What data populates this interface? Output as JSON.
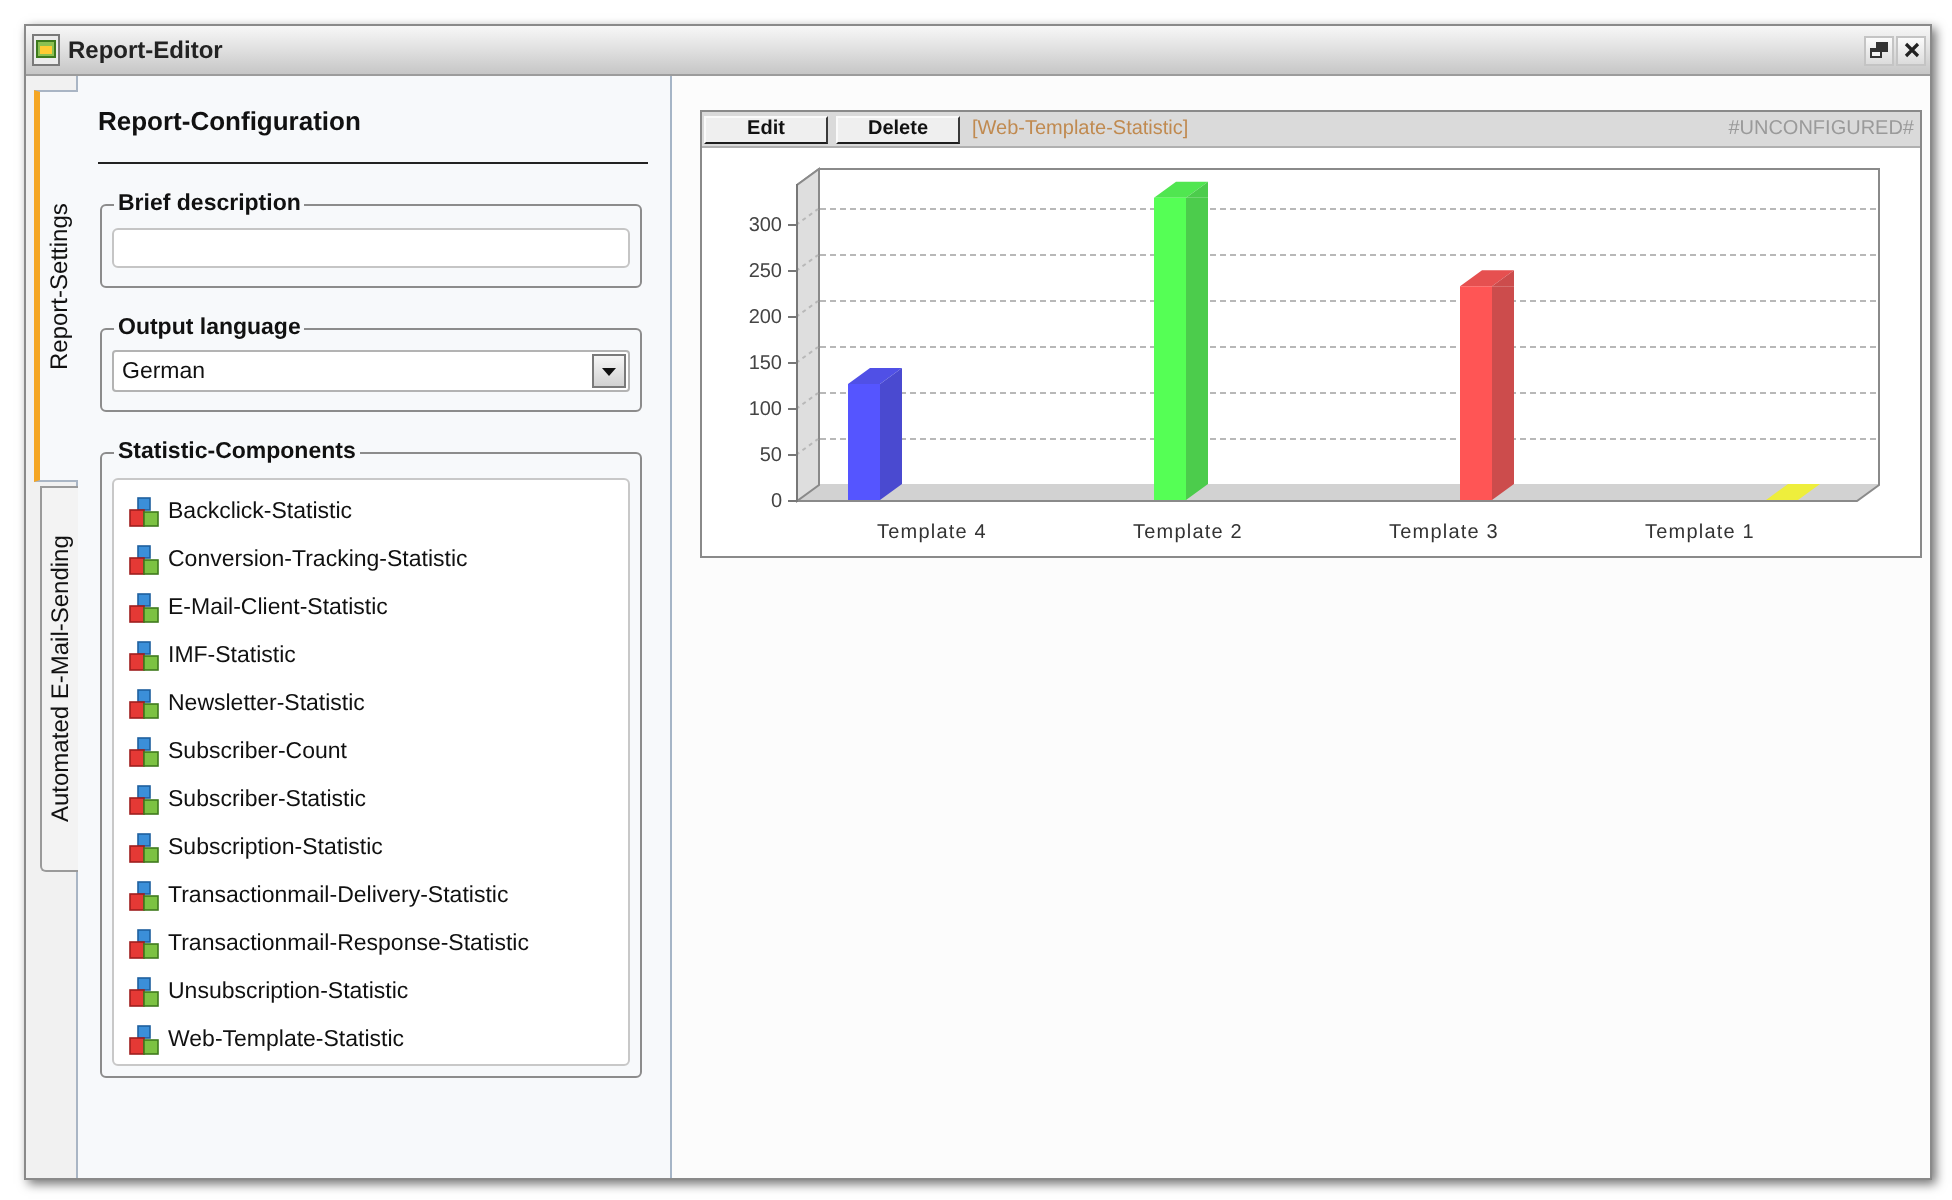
{
  "window": {
    "title": "Report-Editor"
  },
  "tabs": [
    {
      "label": "Report-Settings",
      "selected": true
    },
    {
      "label": "Automated E-Mail-Sending",
      "selected": false
    }
  ],
  "config": {
    "heading": "Report-Configuration",
    "brief_description": {
      "legend": "Brief description"
    },
    "output_language": {
      "legend": "Output language",
      "value": "German"
    },
    "components": {
      "legend": "Statistic-Components",
      "items": [
        {
          "label": "Backclick-Statistic",
          "selected": false
        },
        {
          "label": "Conversion-Tracking-Statistic",
          "selected": false
        },
        {
          "label": "E-Mail-Client-Statistic",
          "selected": false
        },
        {
          "label": "IMF-Statistic",
          "selected": false
        },
        {
          "label": "Newsletter-Statistic",
          "selected": false
        },
        {
          "label": "Subscriber-Count",
          "selected": false
        },
        {
          "label": "Subscriber-Statistic",
          "selected": false
        },
        {
          "label": "Subscription-Statistic",
          "selected": false
        },
        {
          "label": "Transactionmail-Delivery-Statistic",
          "selected": false
        },
        {
          "label": "Transactionmail-Response-Statistic",
          "selected": false
        },
        {
          "label": "Unsubscription-Statistic",
          "selected": false
        },
        {
          "label": "Web-Template-Statistic",
          "selected": false
        }
      ]
    }
  },
  "report": {
    "buttons": [
      "Edit",
      "Delete"
    ],
    "component": "[Web-Template-Statistic]",
    "status": "#UNCONFIGURED#",
    "chart_data": {
      "type": "bar",
      "categories": [
        "Template 4",
        "Template 2",
        "Template 3",
        "Template 1"
      ],
      "values": [
        126,
        328,
        232,
        0
      ],
      "ylim": [
        0,
        343
      ],
      "yticks": [
        0,
        50,
        100,
        150,
        200,
        250,
        300
      ]
    }
  }
}
